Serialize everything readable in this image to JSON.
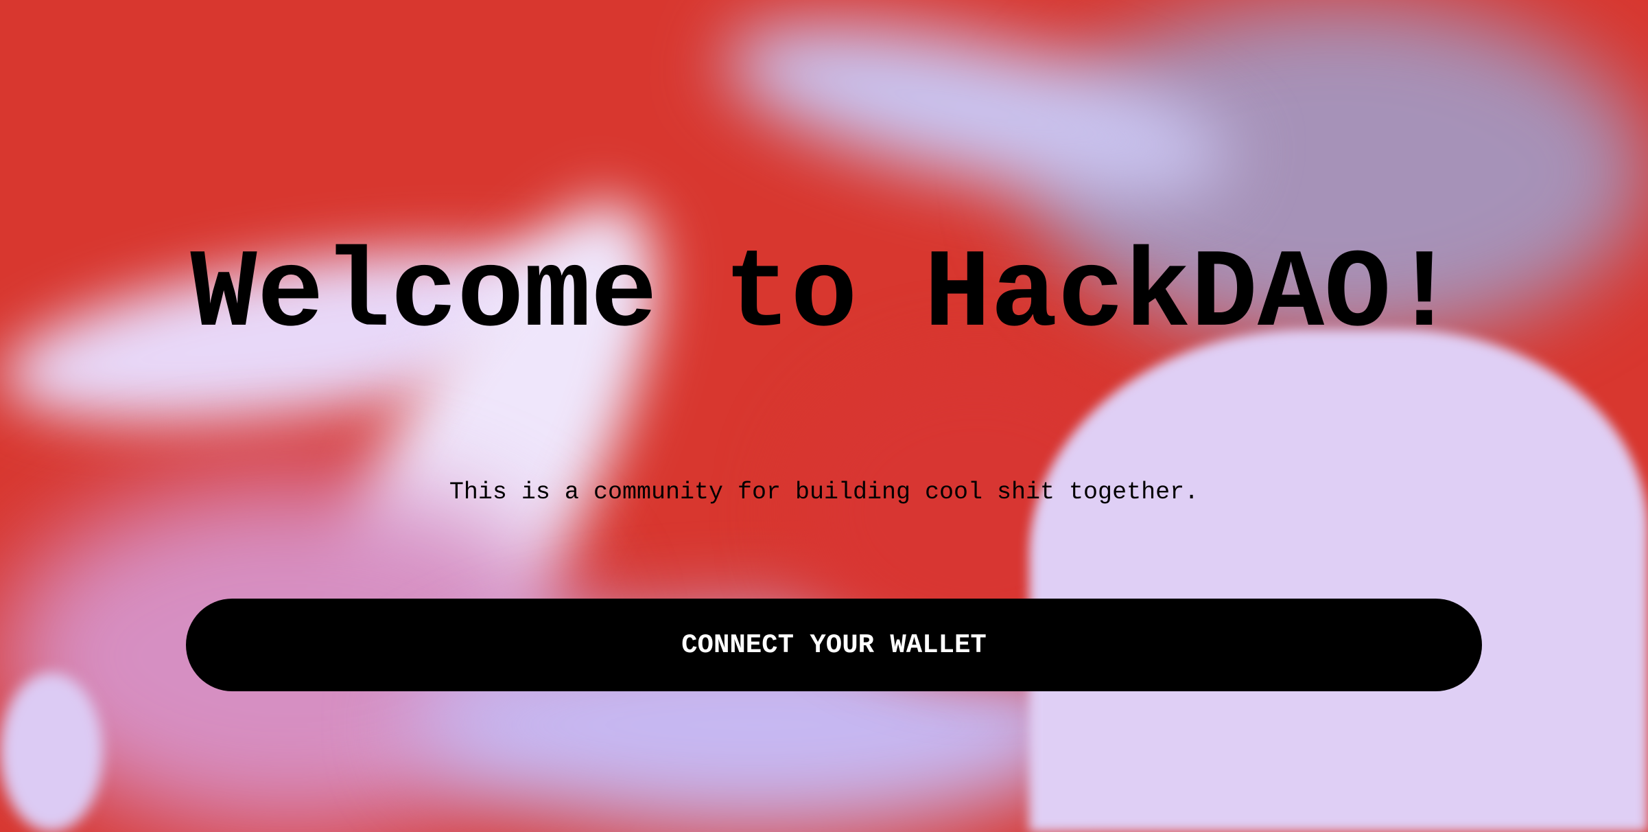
{
  "hero": {
    "title": "Welcome to HackDAO!",
    "subtitle": "This is a community for building cool shit together.",
    "connect_label": "CONNECT YOUR WALLET"
  },
  "colors": {
    "background_primary": "#d8372f",
    "background_secondary": "#dfcff5",
    "button": "#000000",
    "button_text": "#ffffff"
  }
}
